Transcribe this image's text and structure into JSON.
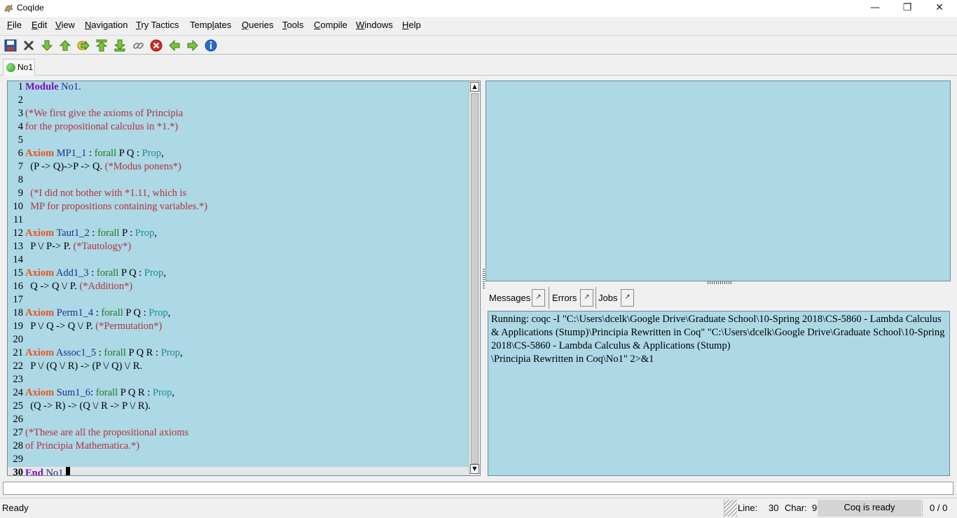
{
  "window": {
    "title": "CoqIde",
    "minimize_label": "—",
    "maximize_label": "❐",
    "close_label": "✕"
  },
  "menu": {
    "items": [
      {
        "first": "F",
        "rest": "ile"
      },
      {
        "first": "E",
        "rest": "dit"
      },
      {
        "first": "V",
        "rest": "iew"
      },
      {
        "first": "N",
        "rest": "avigation"
      },
      {
        "first": "T",
        "rest": "ry Tactics"
      },
      {
        "pre": "Temp",
        "first": "l",
        "rest": "ates"
      },
      {
        "first": "Q",
        "rest": "ueries"
      },
      {
        "first": "T",
        "rest": "ools"
      },
      {
        "first": "C",
        "rest": "ompile"
      },
      {
        "first": "W",
        "rest": "indows"
      },
      {
        "first": "H",
        "rest": "elp"
      }
    ]
  },
  "toolbar": {
    "icons": [
      "save-icon",
      "close-icon",
      "forward-one-icon",
      "backward-one-icon",
      "go-to-cursor-icon",
      "go-to-start-icon",
      "go-to-end-icon",
      "link-icon",
      "interrupt-icon",
      "previous-occurrence-icon",
      "next-occurrence-icon",
      "info-icon"
    ],
    "accent_green": "#39a02a",
    "stop_red": "#d62b1f",
    "info_blue": "#2a6bd1"
  },
  "tabs": [
    {
      "label": "No1",
      "status_color": "#3cb028"
    }
  ],
  "editor": {
    "background": "#add8e6",
    "lines": [
      {
        "n": "1",
        "tokens": [
          [
            "kw",
            "Module"
          ],
          [
            "idn",
            " No1."
          ]
        ]
      },
      {
        "n": "2",
        "tokens": []
      },
      {
        "n": "3",
        "tokens": [
          [
            "cm",
            "(*We first give the axioms of Principia"
          ]
        ]
      },
      {
        "n": "4",
        "tokens": [
          [
            "cm",
            "for the propositional calculus in *1.*)"
          ]
        ]
      },
      {
        "n": "5",
        "tokens": []
      },
      {
        "n": "6",
        "tokens": [
          [
            "kw2",
            "Axiom"
          ],
          [
            "idn",
            " MP1_1"
          ],
          [
            "tx",
            " : "
          ],
          [
            "fa",
            "forall"
          ],
          [
            "tx",
            " P Q : "
          ],
          [
            "ty",
            "Prop"
          ],
          [
            "tx",
            ","
          ]
        ]
      },
      {
        "n": "7",
        "tokens": [
          [
            "tx",
            "  (P -> Q)->P -> Q. "
          ],
          [
            "cm",
            "(*Modus ponens*)"
          ]
        ]
      },
      {
        "n": "8",
        "tokens": [
          [
            "tx",
            ""
          ]
        ]
      },
      {
        "n": "9",
        "tokens": [
          [
            "cm",
            "  (*I did not bother with *1.11, which is"
          ]
        ]
      },
      {
        "n": "10",
        "tokens": [
          [
            "cm",
            "  MP for propositions containing variables.*)"
          ]
        ]
      },
      {
        "n": "11",
        "tokens": []
      },
      {
        "n": "12",
        "tokens": [
          [
            "kw2",
            "Axiom"
          ],
          [
            "idn",
            " Taut1_2"
          ],
          [
            "tx",
            " : "
          ],
          [
            "fa",
            "forall"
          ],
          [
            "tx",
            " P : "
          ],
          [
            "ty",
            "Prop"
          ],
          [
            "tx",
            ","
          ]
        ]
      },
      {
        "n": "13",
        "tokens": [
          [
            "tx",
            "  P \\/ P-> P. "
          ],
          [
            "cm",
            "(*Tautology*)"
          ]
        ]
      },
      {
        "n": "14",
        "tokens": []
      },
      {
        "n": "15",
        "tokens": [
          [
            "kw2",
            "Axiom"
          ],
          [
            "idn",
            " Add1_3"
          ],
          [
            "tx",
            " : "
          ],
          [
            "fa",
            "forall"
          ],
          [
            "tx",
            " P Q : "
          ],
          [
            "ty",
            "Prop"
          ],
          [
            "tx",
            ","
          ]
        ]
      },
      {
        "n": "16",
        "tokens": [
          [
            "tx",
            "  Q -> Q \\/ P. "
          ],
          [
            "cm",
            "(*Addition*)"
          ]
        ]
      },
      {
        "n": "17",
        "tokens": []
      },
      {
        "n": "18",
        "tokens": [
          [
            "kw2",
            "Axiom"
          ],
          [
            "idn",
            " Perm1_4"
          ],
          [
            "tx",
            " : "
          ],
          [
            "fa",
            "forall"
          ],
          [
            "tx",
            " P Q : "
          ],
          [
            "ty",
            "Prop"
          ],
          [
            "tx",
            ","
          ]
        ]
      },
      {
        "n": "19",
        "tokens": [
          [
            "tx",
            "  P \\/ Q -> Q \\/ P. "
          ],
          [
            "cm",
            "(*Permutation*)"
          ]
        ]
      },
      {
        "n": "20",
        "tokens": []
      },
      {
        "n": "21",
        "tokens": [
          [
            "kw2",
            "Axiom"
          ],
          [
            "idn",
            " Assoc1_5"
          ],
          [
            "tx",
            " : "
          ],
          [
            "fa",
            "forall"
          ],
          [
            "tx",
            " P Q R : "
          ],
          [
            "ty",
            "Prop"
          ],
          [
            "tx",
            ","
          ]
        ]
      },
      {
        "n": "22",
        "tokens": [
          [
            "tx",
            "  P \\/ (Q \\/ R) -> (P \\/ Q) \\/ R."
          ]
        ]
      },
      {
        "n": "23",
        "tokens": []
      },
      {
        "n": "24",
        "tokens": [
          [
            "kw2",
            "Axiom"
          ],
          [
            "idn",
            " Sum1_6"
          ],
          [
            "tx",
            ": "
          ],
          [
            "fa",
            "forall"
          ],
          [
            "tx",
            " P Q R : "
          ],
          [
            "ty",
            "Prop"
          ],
          [
            "tx",
            ","
          ]
        ]
      },
      {
        "n": "25",
        "tokens": [
          [
            "tx",
            "  (Q -> R) -> (Q \\/ R -> P \\/ R)."
          ]
        ]
      },
      {
        "n": "26",
        "tokens": []
      },
      {
        "n": "27",
        "tokens": [
          [
            "cm",
            "(*These are all the propositional axioms"
          ]
        ]
      },
      {
        "n": "28",
        "tokens": [
          [
            "cm",
            "of Principia Mathematica.*)"
          ]
        ]
      },
      {
        "n": "29",
        "tokens": []
      },
      {
        "n": "30",
        "tokens": [
          [
            "kw",
            "End"
          ],
          [
            "idn",
            " No1."
          ]
        ],
        "current": true
      }
    ]
  },
  "message_tabs": {
    "messages": "Messages",
    "errors": "Errors",
    "jobs": "Jobs",
    "detach": "↗"
  },
  "messages": {
    "text": "Running: coqc -I \"C:\\Users\\dcelk\\Google Drive\\Graduate School\\10-Spring 2018\\CS-5860 - Lambda Calculus & Applications (Stump)\\Principia Rewritten in Coq\" \"C:\\Users\\dcelk\\Google Drive\\Graduate School\\10-Spring 2018\\CS-5860 - Lambda Calculus & Applications (Stump)\n\\Principia Rewritten in Coq\\No1\" 2>&1"
  },
  "status": {
    "ready": "Ready",
    "line_label": "Line:",
    "line_value": "30",
    "char_label": "Char:",
    "char_value": "9",
    "coq_status": "Coq is ready",
    "progress": "0 / 0"
  }
}
